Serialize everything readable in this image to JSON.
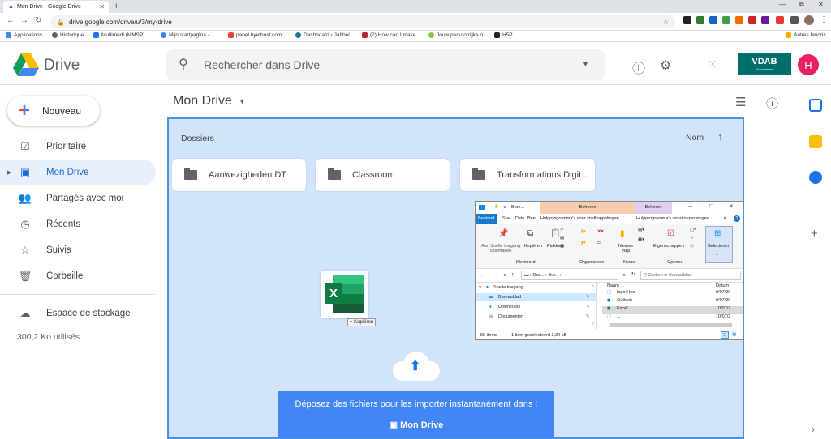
{
  "browser": {
    "tab_title": "Mon Drive - Google Drive",
    "url": "drive.google.com/drive/u/3/my-drive",
    "bookmarks": [
      {
        "label": "Applications",
        "color": "#ea4335"
      },
      {
        "label": "Historique",
        "color": "#5f6368"
      },
      {
        "label": "Multimedi (MMSP)...",
        "color": "#1a73e8"
      },
      {
        "label": "Mijn startpagina -...",
        "color": "#4285f4"
      },
      {
        "label": "panel.byethost.com...",
        "color": "#ea4335"
      },
      {
        "label": "Dashboard ‹ Jabbel...",
        "color": "#21759b"
      },
      {
        "label": "(2) How can I make...",
        "color": "#f48024"
      },
      {
        "label": "Jouw persoonlijke o...",
        "color": "#8bc34a"
      },
      {
        "label": "H5P",
        "color": "#222222"
      }
    ],
    "other_bookmarks": "Autres favoris"
  },
  "header": {
    "logo_text": "Drive",
    "search_placeholder": "Rechercher dans Drive",
    "org_logo": "VDAB",
    "org_logo_sub": "Vlaanderen",
    "avatar_initial": "H"
  },
  "sidebar": {
    "new_button": "Nouveau",
    "items": [
      {
        "label": "Prioritaire",
        "icon": "check-square-icon"
      },
      {
        "label": "Mon Drive",
        "icon": "my-drive-icon",
        "active": true
      },
      {
        "label": "Partagés avec moi",
        "icon": "people-icon"
      },
      {
        "label": "Récents",
        "icon": "clock-icon"
      },
      {
        "label": "Suivis",
        "icon": "star-icon"
      },
      {
        "label": "Corbeille",
        "icon": "trash-icon"
      }
    ],
    "storage_label": "Espace de stockage",
    "storage_usage": "300,2 Ko utilisés"
  },
  "main": {
    "title": "Mon Drive",
    "section_label": "Dossiers",
    "sort_label": "Nom",
    "folders": [
      "Aanwezigheden DT",
      "Classroom",
      "Transformations Digit..."
    ],
    "drop_message": "Déposez des fichiers pour les importer instantanément dans :",
    "drop_target": "Mon Drive",
    "copy_tooltip": "+ Kopiëren"
  },
  "explorer": {
    "title_path": "Bure...",
    "context_tab_1": "Beheren",
    "context_tab_2": "Beheren",
    "ribbon_tabs": [
      "Bestand",
      "Star",
      "Dele",
      "Beel",
      "Hulpprogramma's voor snelkoppelingen",
      "Hulpprogramma's voor toepassingen"
    ],
    "ribbon_buttons": [
      "Aan Snelle toegang vastmaken",
      "Kopiëren",
      "Plakken",
      "Nieuwe map",
      "Eigenschappen",
      "Selecteren"
    ],
    "ribbon_groups": [
      "Klembord",
      "Organiseren",
      "Nieuw",
      "Openen"
    ],
    "breadcrumb": "› Dez... › Bur... ›",
    "search_placeholder": "Zoeken in Bureaublad",
    "tree": [
      "Snelle toegang",
      "Bureaublad",
      "Downloads",
      "Documenten"
    ],
    "col_name": "Naam",
    "col_date": "Datum",
    "files": [
      {
        "name": "logo-Heo",
        "date": "9/07/20"
      },
      {
        "name": "Outlook",
        "date": "9/07/20"
      },
      {
        "name": "Excel",
        "date": "10/07/2"
      },
      {
        "name": "...",
        "date": "10/07/2"
      }
    ],
    "status_items": "55 items",
    "status_selected": "1 item geselecteerd  2,34 kB"
  },
  "colors": {
    "accent": "#1a73e8",
    "drop_bg": "#d2e3fc",
    "active_nav_bg": "#e8f0fe"
  }
}
